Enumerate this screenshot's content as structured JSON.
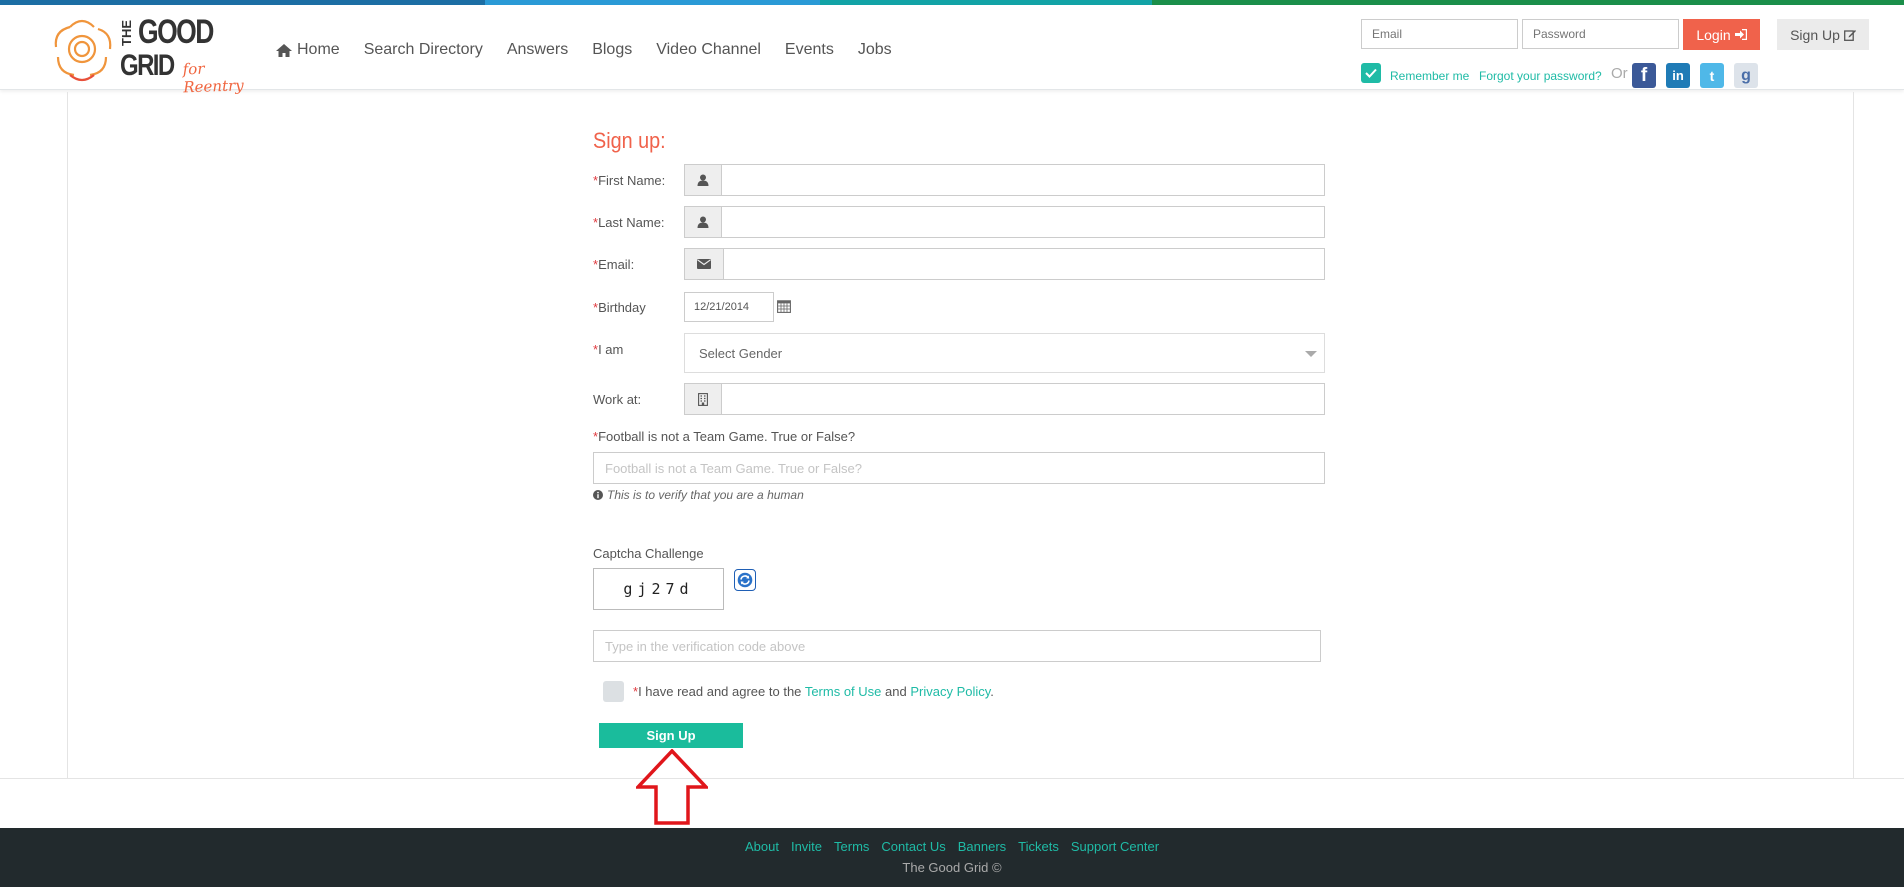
{
  "header": {
    "brand": {
      "line1": "THE",
      "line2": "GOOD",
      "line3": "GRID",
      "tagline": "for Reentry"
    },
    "nav": [
      "Home",
      "Search Directory",
      "Answers",
      "Blogs",
      "Video Channel",
      "Events",
      "Jobs"
    ],
    "email_placeholder": "Email",
    "password_placeholder": "Password",
    "login_label": "Login",
    "signup_label": "Sign Up",
    "remember_label": "Remember me",
    "forgot_label": "Forgot your password?",
    "or_label": "Or",
    "social_icons": [
      "facebook-icon",
      "linkedin-icon",
      "twitter-icon",
      "google-icon"
    ]
  },
  "form": {
    "title": "Sign up:",
    "required_mark": "*",
    "first_name_label": "First Name:",
    "last_name_label": "Last Name:",
    "email_label": "Email:",
    "birthday_label": "Birthday",
    "birthday_value": "12/21/2014",
    "iam_label": "I am",
    "gender_selected": "Select Gender",
    "work_label": "Work at:",
    "question_label": "Football is not a Team Game. True or False?",
    "question_placeholder": "Football is not a Team Game. True or False?",
    "human_hint": "This is to verify that you are a human",
    "captcha_label": "Captcha Challenge",
    "captcha_code": "gj27d",
    "verify_placeholder": "Type in the verification code above",
    "agree_prefix": "I have read and agree to the",
    "terms_link": "Terms of Use",
    "agree_and": "and",
    "privacy_link": "Privacy Policy",
    "agree_suffix": ".",
    "submit_label": "Sign Up"
  },
  "footer": {
    "links": [
      "About",
      "Invite",
      "Terms",
      "Contact Us",
      "Banners",
      "Tickets",
      "Support Center"
    ],
    "copyright": "The Good Grid ©"
  },
  "colors": {
    "accent": "#1abc9c",
    "brand_orange": "#f0624b",
    "footer_bg": "#222a2d",
    "stripe": [
      "#1c6ea4",
      "#2a9ad6",
      "#12a3a6",
      "#1b8f4a"
    ]
  }
}
